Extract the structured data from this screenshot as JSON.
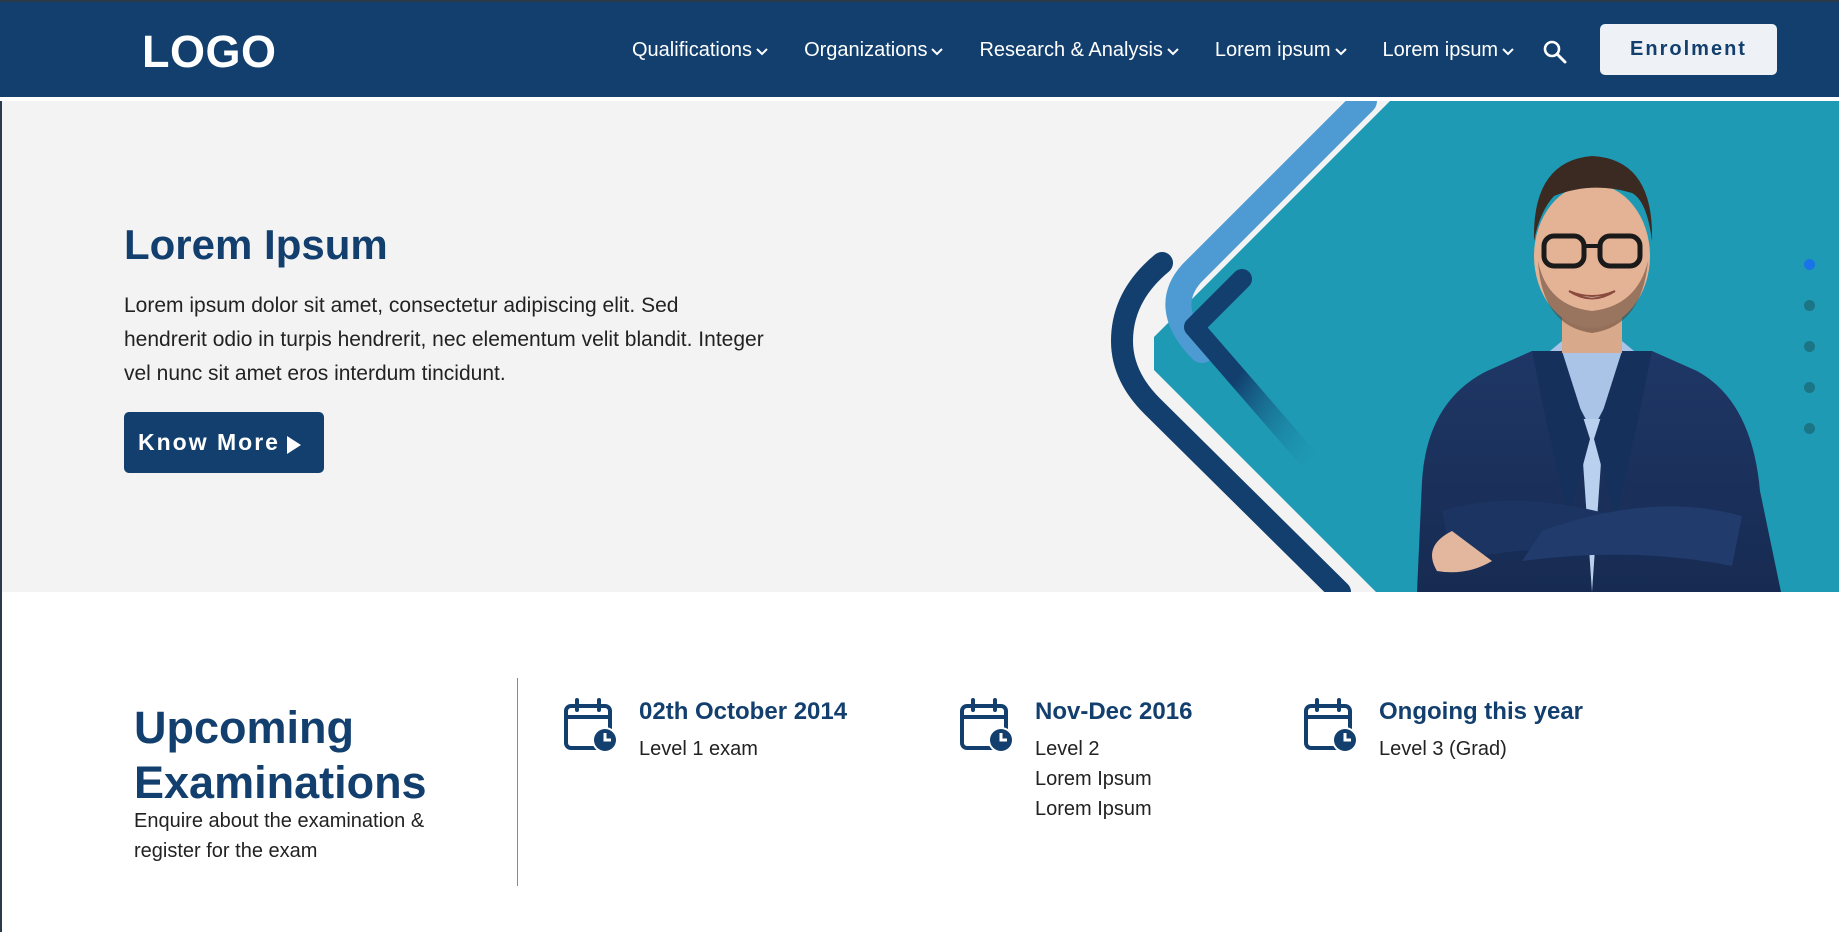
{
  "header": {
    "logo": "LOGO",
    "nav": [
      {
        "label": "Qualifications"
      },
      {
        "label": "Organizations"
      },
      {
        "label": "Research & Analysis"
      },
      {
        "label": "Lorem ipsum"
      },
      {
        "label": "Lorem ipsum"
      }
    ],
    "search_icon": "search-icon",
    "enrol_label": "Enrolment"
  },
  "hero": {
    "title": "Lorem Ipsum",
    "text": "Lorem ipsum dolor sit amet, consectetur adipiscing elit. Sed hendrerit odio in turpis hendrerit, nec elementum velit blandit. Integer vel nunc sit amet eros interdum tincidunt.",
    "button_label": "Know More",
    "slide_count": 5,
    "active_slide": 1
  },
  "exams": {
    "title": "Upcoming Examinations",
    "subtitle": "Enquire about the examination & register for the exam",
    "items": [
      {
        "date": "02th October 2014",
        "lines": [
          "Level 1 exam"
        ]
      },
      {
        "date": "Nov-Dec 2016",
        "lines": [
          "Level 2",
          "Lorem Ipsum",
          "Lorem Ipsum"
        ]
      },
      {
        "date": "Ongoing this year",
        "lines": [
          "Level 3 (Grad)"
        ]
      }
    ]
  },
  "colors": {
    "brand_navy": "#123f6e",
    "teal": "#1e9ab4",
    "light_blue": "#4e9bd4",
    "hero_bg": "#f3f3f3",
    "active_dot": "#1a73e8"
  }
}
